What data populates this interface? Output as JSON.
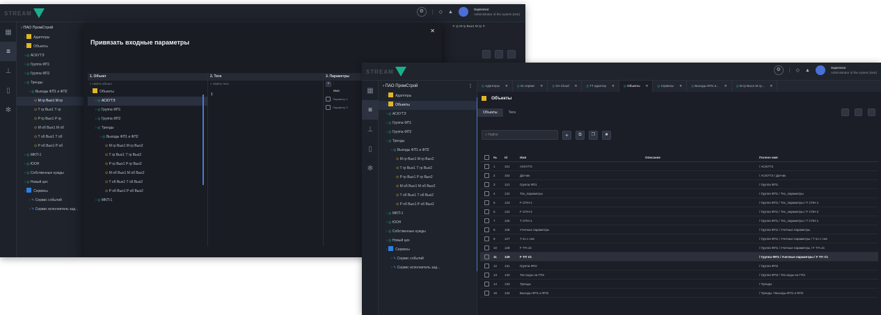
{
  "brand": {
    "logo_text": "STREAM",
    "accent_color": "#19b08e"
  },
  "back_window": {
    "top_right": {
      "user_name": "Supervisor",
      "user_sub": "Administrator of the system (test)"
    },
    "sidebar_root": "ПАО ПромСтрой",
    "tree": [
      {
        "label": "Адаптеры",
        "depth": 1,
        "icon": "folder"
      },
      {
        "label": "Объекты",
        "depth": 1,
        "icon": "folder"
      },
      {
        "label": "АСКУТЭ",
        "depth": 1,
        "icon": "pin"
      },
      {
        "label": "Группа ФП1",
        "depth": 1,
        "icon": "pin"
      },
      {
        "label": "Группа ФП2",
        "depth": 1,
        "icon": "pin"
      },
      {
        "label": "Тренды",
        "depth": 1,
        "icon": "pin"
      },
      {
        "label": "Выходы ФП1 и ФП2",
        "depth": 2,
        "icon": "pin"
      },
      {
        "label": "M гр Вых1 M гр",
        "depth": 3,
        "icon": "dot",
        "active": true
      },
      {
        "label": "T гр Вых1 T гр",
        "depth": 3,
        "icon": "dot"
      },
      {
        "label": "P гр Вых1 P гр",
        "depth": 3,
        "icon": "dot"
      },
      {
        "label": "M об Вых1 M об",
        "depth": 3,
        "icon": "dot"
      },
      {
        "label": "T об Вых1 T об",
        "depth": 3,
        "icon": "dot"
      },
      {
        "label": "P об Вых1 P об",
        "depth": 3,
        "icon": "dot"
      },
      {
        "label": "MKП-1",
        "depth": 1,
        "icon": "pin"
      },
      {
        "label": "ЮОН",
        "depth": 1,
        "icon": "pin"
      },
      {
        "label": "Собственные нужды",
        "depth": 1,
        "icon": "pin"
      },
      {
        "label": "Новый цех",
        "depth": 1,
        "icon": "pin"
      },
      {
        "label": "Сервисы",
        "depth": 1,
        "icon": "blue"
      },
      {
        "label": "Сервис событий",
        "depth": 2,
        "icon": "wrench"
      },
      {
        "label": "Сервис исполнитель зад...",
        "depth": 2,
        "icon": "wrench"
      }
    ],
    "tab_peek": "M гр Вых1 M гр",
    "modal": {
      "title": "Привязать входные параметры",
      "col1_header": "1. Объект",
      "col2_header": "2. Теги",
      "col3_header": "3. Параметры",
      "col1_search": "Найти объект",
      "col2_search": "Найти теги",
      "col3_sub": "Имя",
      "col3_items": [
        "Параметр 1",
        "Параметр 2"
      ],
      "col2_value": "1",
      "tree": [
        {
          "label": "Объекты",
          "depth": 0,
          "icon": "folder"
        },
        {
          "label": "АСКУТЭ",
          "depth": 1,
          "icon": "pin",
          "active": true
        },
        {
          "label": "Группа ФП1",
          "depth": 1,
          "icon": "pin"
        },
        {
          "label": "Группа ФП2",
          "depth": 1,
          "icon": "pin"
        },
        {
          "label": "Тренды",
          "depth": 1,
          "icon": "pin"
        },
        {
          "label": "Выходы ФП1 и ФП2",
          "depth": 2,
          "icon": "pin"
        },
        {
          "label": "M гр Вых1 M гр Вых2",
          "depth": 3,
          "icon": "dot"
        },
        {
          "label": "T гр Вых1 T гр Вых2",
          "depth": 3,
          "icon": "dot"
        },
        {
          "label": "P гр Вых1 P гр Вых2",
          "depth": 3,
          "icon": "dot"
        },
        {
          "label": "M об Вых1 M об Вых2",
          "depth": 3,
          "icon": "dot"
        },
        {
          "label": "T об Вых1 T об Вых2",
          "depth": 3,
          "icon": "dot"
        },
        {
          "label": "P об Вых1 P об Вых2",
          "depth": 3,
          "icon": "dot"
        },
        {
          "label": "MKП-1",
          "depth": 1,
          "icon": "pin"
        }
      ]
    }
  },
  "front_window": {
    "top_right": {
      "user_name": "Supervisor",
      "user_sub": "Administrator of the system (test)"
    },
    "sidebar_root": "ПАО ПромСтрой",
    "tree": [
      {
        "label": "Адаптеры",
        "depth": 1,
        "icon": "folder"
      },
      {
        "label": "Объекты",
        "depth": 1,
        "icon": "folder",
        "active": true
      },
      {
        "label": "АСКУТЭ",
        "depth": 1,
        "icon": "pin"
      },
      {
        "label": "Группа ФП1",
        "depth": 1,
        "icon": "pin"
      },
      {
        "label": "Группа ФП2",
        "depth": 1,
        "icon": "pin"
      },
      {
        "label": "Тренды",
        "depth": 1,
        "icon": "pin"
      },
      {
        "label": "Выходы ФП1 и ФП2",
        "depth": 2,
        "icon": "pin"
      },
      {
        "label": "M гр Вых1 M гр Вых2",
        "depth": 3,
        "icon": "dot"
      },
      {
        "label": "T гр Вых1 T гр Вых2",
        "depth": 3,
        "icon": "dot"
      },
      {
        "label": "P гр Вых1 P гр Вых2",
        "depth": 3,
        "icon": "dot"
      },
      {
        "label": "M об Вых1 M об Вых2",
        "depth": 3,
        "icon": "dot"
      },
      {
        "label": "T об Вых1 T об Вых2",
        "depth": 3,
        "icon": "dot"
      },
      {
        "label": "P об Вых1 P об Вых2",
        "depth": 3,
        "icon": "dot"
      },
      {
        "label": "MKП-1",
        "depth": 1,
        "icon": "pin"
      },
      {
        "label": "ЮОН",
        "depth": 1,
        "icon": "pin"
      },
      {
        "label": "Собственные нужды",
        "depth": 1,
        "icon": "pin"
      },
      {
        "label": "Новый цех",
        "depth": 1,
        "icon": "pin"
      },
      {
        "label": "Сервисы",
        "depth": 1,
        "icon": "blue"
      },
      {
        "label": "Сервис событий",
        "depth": 2,
        "icon": "wrench"
      },
      {
        "label": "Сервис исполнитель зад...",
        "depth": 2,
        "icon": "wrench"
      }
    ],
    "tabs": [
      {
        "label": "Адаптеры"
      },
      {
        "label": "0с сервис"
      },
      {
        "label": "OA Cloud"
      },
      {
        "label": "ГТ адаптер"
      },
      {
        "label": "Объекты",
        "active": true
      },
      {
        "label": "Сервисы"
      },
      {
        "label": "Выходы ФП1 и..."
      },
      {
        "label": "M гр Вых1 M гр..."
      }
    ],
    "page_title": "Объекты",
    "subtabs": [
      "Объекты",
      "Теги"
    ],
    "search_placeholder": "Найти",
    "columns": {
      "num": "№",
      "id": "Id",
      "name": "Имя",
      "desc": "Описание",
      "full": "Полное имя"
    },
    "rows": [
      {
        "n": "1",
        "id": "101",
        "name": "АСКУТЭ",
        "full": "/ АСКУТЭ"
      },
      {
        "n": "2",
        "id": "102",
        "name": "Датчик",
        "full": "/ АСКУТЭ / Датчик"
      },
      {
        "n": "3",
        "id": "121",
        "name": "Группа ФП1",
        "full": "/ Группа ФП1"
      },
      {
        "n": "4",
        "id": "122",
        "name": "Тех_параметры",
        "full": "/ Группа ФП1 / Тех_параметры"
      },
      {
        "n": "5",
        "id": "123",
        "name": "F СПН-1",
        "full": "/ Группа ФП1 / Тех_параметры / F СПН-1"
      },
      {
        "n": "6",
        "id": "124",
        "name": "F СПН-2",
        "full": "/ Группа ФП1 / Тех_параметры / F СПН-2"
      },
      {
        "n": "7",
        "id": "125",
        "name": "T СПН-1",
        "full": "/ Группа ФП1 / Тех_параметры / T СПН-1"
      },
      {
        "n": "8",
        "id": "126",
        "name": "Учетные параметры",
        "full": "/ Группа ФП1 / Учетные параметры"
      },
      {
        "n": "9",
        "id": "127",
        "name": "T по с сев",
        "full": "/ Группа ФП1 / Учетные параметры / T по с сев"
      },
      {
        "n": "10",
        "id": "128",
        "name": "F ТП о/с",
        "full": "/ Группа ФП1 / Учетные параметры / F ТП о/с"
      },
      {
        "n": "11",
        "id": "129",
        "name": "F ТП т/с",
        "full": "/ Группа ФП1 / Учетные параметры / F ТП т/с",
        "selected": true
      },
      {
        "n": "12",
        "id": "131",
        "name": "Группа ФП2",
        "full": "/ Группа ФП2"
      },
      {
        "n": "13",
        "id": "132",
        "name": "Тех воды на ГПЗ",
        "full": "/ Группа ФП2 / Тех воды на ГПЗ"
      },
      {
        "n": "14",
        "id": "133",
        "name": "Тренды",
        "full": "/ Тренды"
      },
      {
        "n": "15",
        "id": "134",
        "name": "Выходы ФП1 и ФП2",
        "full": "/ Тренды / Выходы ФП1 и ФП2"
      }
    ]
  }
}
